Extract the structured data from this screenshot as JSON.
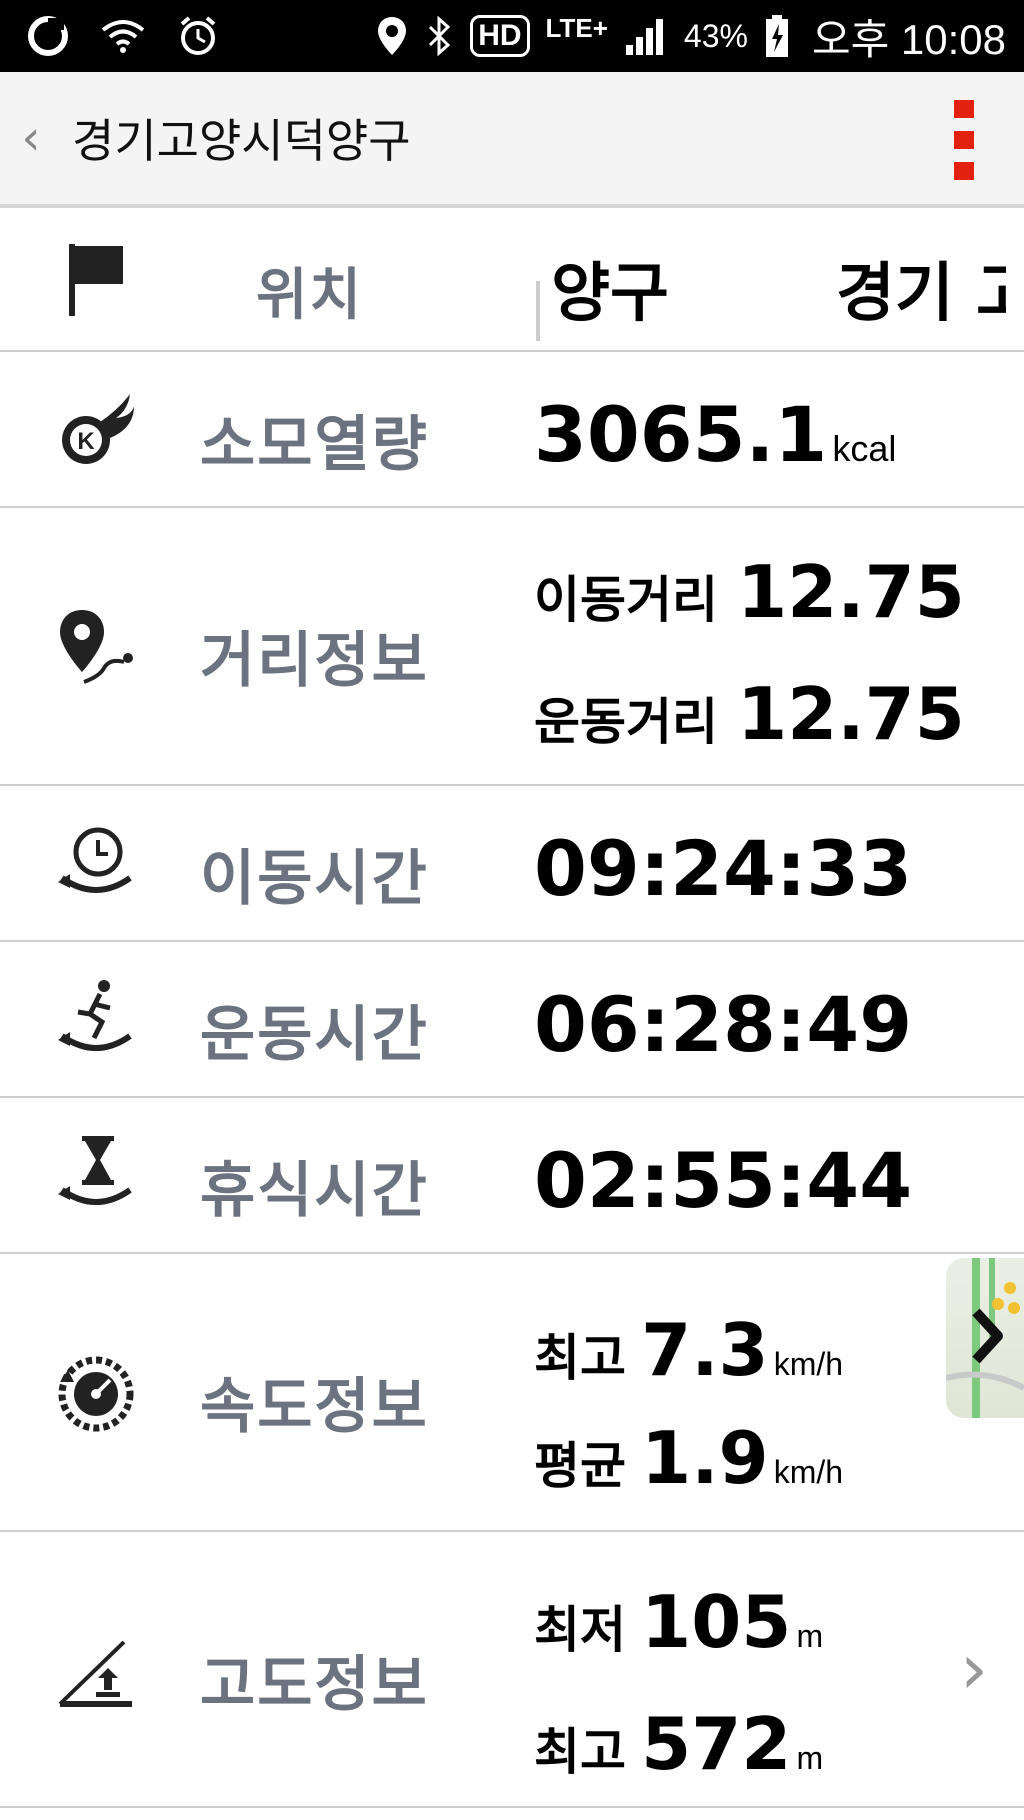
{
  "status_bar": {
    "carrier_icon": "carrier-logo-icon",
    "battery_percent": "43%",
    "time": "오후 10:08",
    "hd_label": "HD",
    "lte_label": "LTE+"
  },
  "app_bar": {
    "title": "경기고양시덕양구",
    "back_icon": "chevron-left-icon",
    "menu_icon": "overflow-menu-icon",
    "accent_color": "#e3210f"
  },
  "rows": {
    "location": {
      "label": "위치",
      "value_left": "양구",
      "value_right": "경기 고"
    },
    "calories": {
      "label": "소모열량",
      "value": "3065.1",
      "unit": "kcal"
    },
    "distance": {
      "label": "거리정보",
      "travel_label": "이동거리",
      "travel_value": "12.75",
      "exercise_label": "운동거리",
      "exercise_value": "12.75"
    },
    "travel_time": {
      "label": "이동시간",
      "value": "09:24:33"
    },
    "exercise_time": {
      "label": "운동시간",
      "value": "06:28:49"
    },
    "rest_time": {
      "label": "휴식시간",
      "value": "02:55:44"
    },
    "speed": {
      "label": "속도정보",
      "max_label": "최고",
      "max_value": "7.3",
      "avg_label": "평균",
      "avg_value": "1.9",
      "unit": "km/h"
    },
    "altitude": {
      "label": "고도정보",
      "min_label": "최저",
      "min_value": "105",
      "max_label": "최고",
      "max_value": "572",
      "unit": "m"
    }
  },
  "colors": {
    "label_gray": "#6b7380",
    "divider": "#cfcfcf",
    "appbar_bg": "#f4f4f4"
  }
}
